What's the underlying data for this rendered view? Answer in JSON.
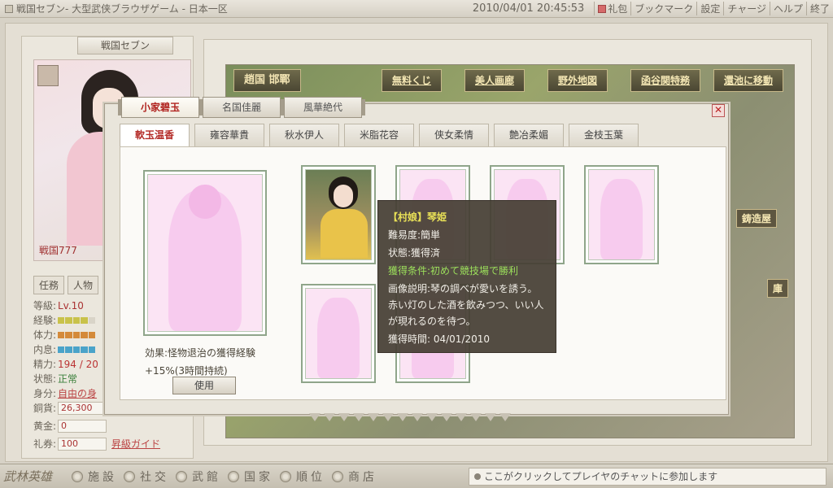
{
  "window": {
    "title": "戦国セブン- 大型武侠ブラウザゲーム - 日本一区",
    "datetime": "2010/04/01 20:45:53",
    "menu": [
      "礼包",
      "ブックマーク",
      "設定",
      "チャージ",
      "ヘルプ",
      "終了"
    ]
  },
  "left": {
    "panel_title": "戦国セブン",
    "char_name": "戦国777",
    "tabs": [
      "任務",
      "人物"
    ],
    "stats": {
      "level_label": "等級:",
      "level_value": "Lv.10",
      "exp_label": "経験:",
      "hp_label": "体力:",
      "mp_label": "内息:",
      "spirit_label": "精力:",
      "spirit_value": "194 / 20",
      "state_label": "状態:",
      "state_value": "正常",
      "identity_label": "身分:",
      "identity_value": "自由の身",
      "copper_label": "銅貨:",
      "copper_value": "26,300",
      "gold_label": "黄金:",
      "gold_value": "0",
      "voucher_label": "礼券:",
      "voucher_value": "100",
      "upgrade_link": "昇級ガイド"
    }
  },
  "map": {
    "location": "趙国 邯鄲",
    "buttons": [
      "無料くじ",
      "美人画廊",
      "野外地図",
      "函谷関特務",
      "還池に移動"
    ],
    "side_labels": [
      "鋳造屋",
      "庫"
    ]
  },
  "dialog": {
    "tabs": [
      "小家碧玉",
      "名国佳麗",
      "風華絶代"
    ],
    "active_tab": 0,
    "close": "✕",
    "subtabs": [
      "軟玉温香",
      "雍容華貴",
      "秋水伊人",
      "米脂花容",
      "侠女柔情",
      "艶冶柔媚",
      "金枝玉葉"
    ],
    "active_subtab": 0,
    "effect_line1": "効果:怪物退治の獲得経験",
    "effect_line2": "+15%(3時間持続)",
    "use_button": "使用",
    "tooltip": {
      "title": "【村娘】琴姫",
      "difficulty": "難易度:簡単",
      "status": "状態:獲得済",
      "condition": "獲得条件:初めて競技場で勝利",
      "desc_label": "画像説明:琴の調べが愛いを誘う。赤い灯のした酒を飲みつつ、いい人が現れるのを待つ。",
      "time": "獲得時間: 04/01/2010"
    }
  },
  "bottom": {
    "logo": "武林英雄",
    "nav": [
      "施設",
      "社交",
      "武館",
      "国家",
      "順位",
      "商店"
    ],
    "chat_placeholder": "ここがクリックしてプレイヤのチャットに参加します"
  },
  "colors": {
    "accent_red": "#b0221e",
    "tooltip_title": "#e8e057",
    "tooltip_green": "#9ce05b"
  }
}
